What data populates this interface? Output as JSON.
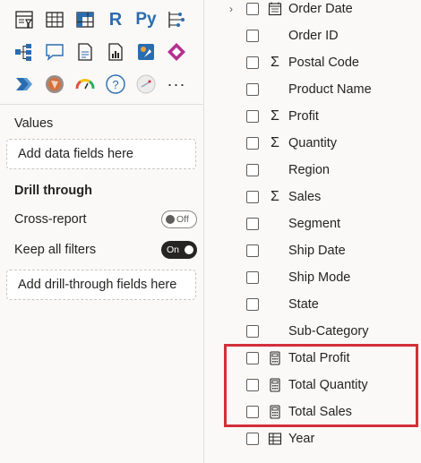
{
  "visualizations": {
    "row1": [
      "slicer-icon",
      "table-icon",
      "matrix-icon",
      "r-script-icon",
      "python-visual-icon",
      "key-influencers-icon"
    ],
    "row2": [
      "decomposition-tree-icon",
      "qa-icon",
      "smart-narrative-icon",
      "paginated-report-icon",
      "power-automate-icon",
      "power-apps-icon"
    ],
    "row3": [
      "power-automate-flow-icon",
      "arcgis-icon",
      "gauge-icon",
      "qna-help-icon",
      "custom-visual-icon",
      "more-visuals-icon"
    ],
    "r_label": "R",
    "py_label": "Py",
    "more_label": "···"
  },
  "values_section": {
    "label": "Values",
    "placeholder": "Add data fields here"
  },
  "drill_through": {
    "heading": "Drill through",
    "cross_report_label": "Cross-report",
    "cross_report_state": "Off",
    "keep_filters_label": "Keep all filters",
    "keep_filters_state": "On",
    "placeholder": "Add drill-through fields here"
  },
  "fields": [
    {
      "name": "Order Date",
      "type": "date-hierarchy",
      "expandable": true
    },
    {
      "name": "Order ID",
      "type": "text",
      "expandable": false
    },
    {
      "name": "Postal Code",
      "type": "sum",
      "expandable": false
    },
    {
      "name": "Product Name",
      "type": "text",
      "expandable": false
    },
    {
      "name": "Profit",
      "type": "sum",
      "expandable": false
    },
    {
      "name": "Quantity",
      "type": "sum",
      "expandable": false
    },
    {
      "name": "Region",
      "type": "text",
      "expandable": false
    },
    {
      "name": "Sales",
      "type": "sum",
      "expandable": false
    },
    {
      "name": "Segment",
      "type": "text",
      "expandable": false
    },
    {
      "name": "Ship Date",
      "type": "text",
      "expandable": false
    },
    {
      "name": "Ship Mode",
      "type": "text",
      "expandable": false
    },
    {
      "name": "State",
      "type": "text",
      "expandable": false
    },
    {
      "name": "Sub-Category",
      "type": "text",
      "expandable": false
    },
    {
      "name": "Total Profit",
      "type": "measure",
      "expandable": false
    },
    {
      "name": "Total Quantity",
      "type": "measure",
      "expandable": false
    },
    {
      "name": "Total Sales",
      "type": "measure",
      "expandable": false
    },
    {
      "name": "Year",
      "type": "table",
      "expandable": false
    }
  ],
  "sum_symbol": "Σ",
  "expander_symbol": "›",
  "colors": {
    "highlight": "#d32f3a",
    "background": "#faf9f8",
    "text": "#252423"
  }
}
